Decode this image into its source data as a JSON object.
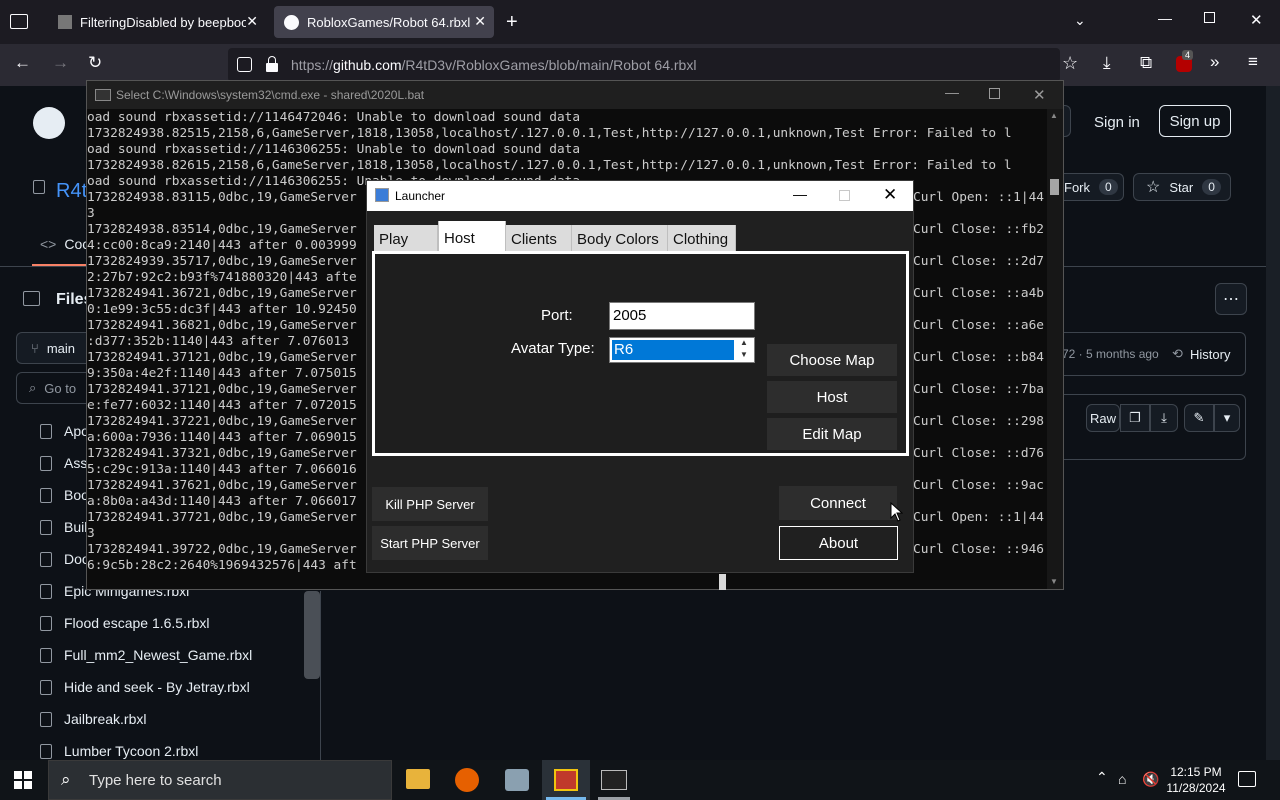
{
  "browser": {
    "tabs": [
      {
        "label": "FilteringDisabled by beepboop",
        "active": false
      },
      {
        "label": "RobloxGames/Robot 64.rbxl at",
        "active": true
      }
    ],
    "url_prefix": "https://",
    "url_host": "github.com",
    "url_path": "/R4tD3v/RobloxGames/blob/main/Robot 64.rbxl",
    "extension_badge": "4"
  },
  "github": {
    "sign_in": "Sign in",
    "sign_up": "Sign up",
    "repo_owner_partial": "R4t",
    "code_tab_partial": "Coc",
    "files_label": "Files",
    "branch": "main",
    "goto_placeholder": "Go to",
    "fork_label": "Fork",
    "fork_count": "0",
    "star_label": "Star",
    "star_count": "0",
    "commit_time": "72 · 5 months ago",
    "history": "History",
    "raw": "Raw",
    "files": [
      "Apo",
      "Ass",
      "Boo",
      "Buil",
      "Doo",
      "Epic Minigames.rbxl",
      "Flood escape 1.6.5.rbxl",
      "Full_mm2_Newest_Game.rbxl",
      "Hide and seek - By Jetray.rbxl",
      "Jailbreak.rbxl",
      "Lumber Tycoon 2.rbxl"
    ]
  },
  "cmd": {
    "title": "Select C:\\Windows\\system32\\cmd.exe - shared\\2020L.bat",
    "lines_left": [
      "oad sound rbxassetid://1146472046: Unable to download sound data",
      "1732824938.82515,2158,6,GameServer,1818,13058,localhost/.127.0.0.1,Test,http://127.0.0.1,unknown,Test Error: Failed to l",
      "oad sound rbxassetid://1146306255: Unable to download sound data",
      "1732824938.82615,2158,6,GameServer,1818,13058,localhost/.127.0.0.1,Test,http://127.0.0.1,unknown,Test Error: Failed to l",
      "oad sound rbxassetid://1146306255: Unable to download sound data",
      "1732824938.83115,0dbc,19,GameServer",
      "3",
      "1732824938.83514,0dbc,19,GameServer",
      "4:cc00:8ca9:2140|443 after 0.003999",
      "1732824939.35717,0dbc,19,GameServer",
      "2:27b7:92c2:b93f%741880320|443 afte",
      "1732824941.36721,0dbc,19,GameServer",
      "0:1e99:3c55:dc3f|443 after 10.92450",
      "1732824941.36821,0dbc,19,GameServer",
      ":d377:352b:1140|443 after 7.076013",
      "1732824941.37121,0dbc,19,GameServer",
      "9:350a:4e2f:1140|443 after 7.075015",
      "1732824941.37121,0dbc,19,GameServer",
      "e:fe77:6032:1140|443 after 7.072015",
      "1732824941.37221,0dbc,19,GameServer",
      "a:600a:7936:1140|443 after 7.069015",
      "1732824941.37321,0dbc,19,GameServer",
      "5:c29c:913a:1140|443 after 7.066016",
      "1732824941.37621,0dbc,19,GameServer",
      "a:8b0a:a43d:1140|443 after 7.066017",
      "1732824941.37721,0dbc,19,GameServer",
      "3",
      "1732824941.39722,0dbc,19,GameServer",
      "6:9c5b:28c2:2640%1969432576|443 aft"
    ],
    "lines_right": [
      "Curl Open: ::1|44",
      "",
      "Curl Close: ::fb2",
      "",
      "Curl Close: ::2d7",
      "",
      "Curl Close: ::a4b",
      "",
      "Curl Close: ::a6e",
      "",
      "Curl Close: ::b84",
      "",
      "Curl Close: ::7ba",
      "",
      "Curl Close: ::298",
      "",
      "Curl Close: ::d76",
      "",
      "Curl Close: ::9ac",
      "",
      "Curl Open: ::1|44",
      "",
      "Curl Close: ::946"
    ]
  },
  "launcher": {
    "title": "Launcher",
    "tabs": [
      "Play",
      "Host",
      "Clients",
      "Body Colors",
      "Clothing"
    ],
    "active_tab": "Host",
    "port_label": "Port:",
    "port_value": "2005",
    "avatar_label": "Avatar Type:",
    "avatar_value": "R6",
    "choose_map": "Choose Map",
    "host": "Host",
    "edit_map": "Edit Map",
    "kill_php": "Kill PHP Server",
    "start_php": "Start PHP Server",
    "connect": "Connect",
    "about": "About"
  },
  "taskbar": {
    "search_placeholder": "Type here to search",
    "time": "12:15 PM",
    "date": "11/28/2024"
  }
}
